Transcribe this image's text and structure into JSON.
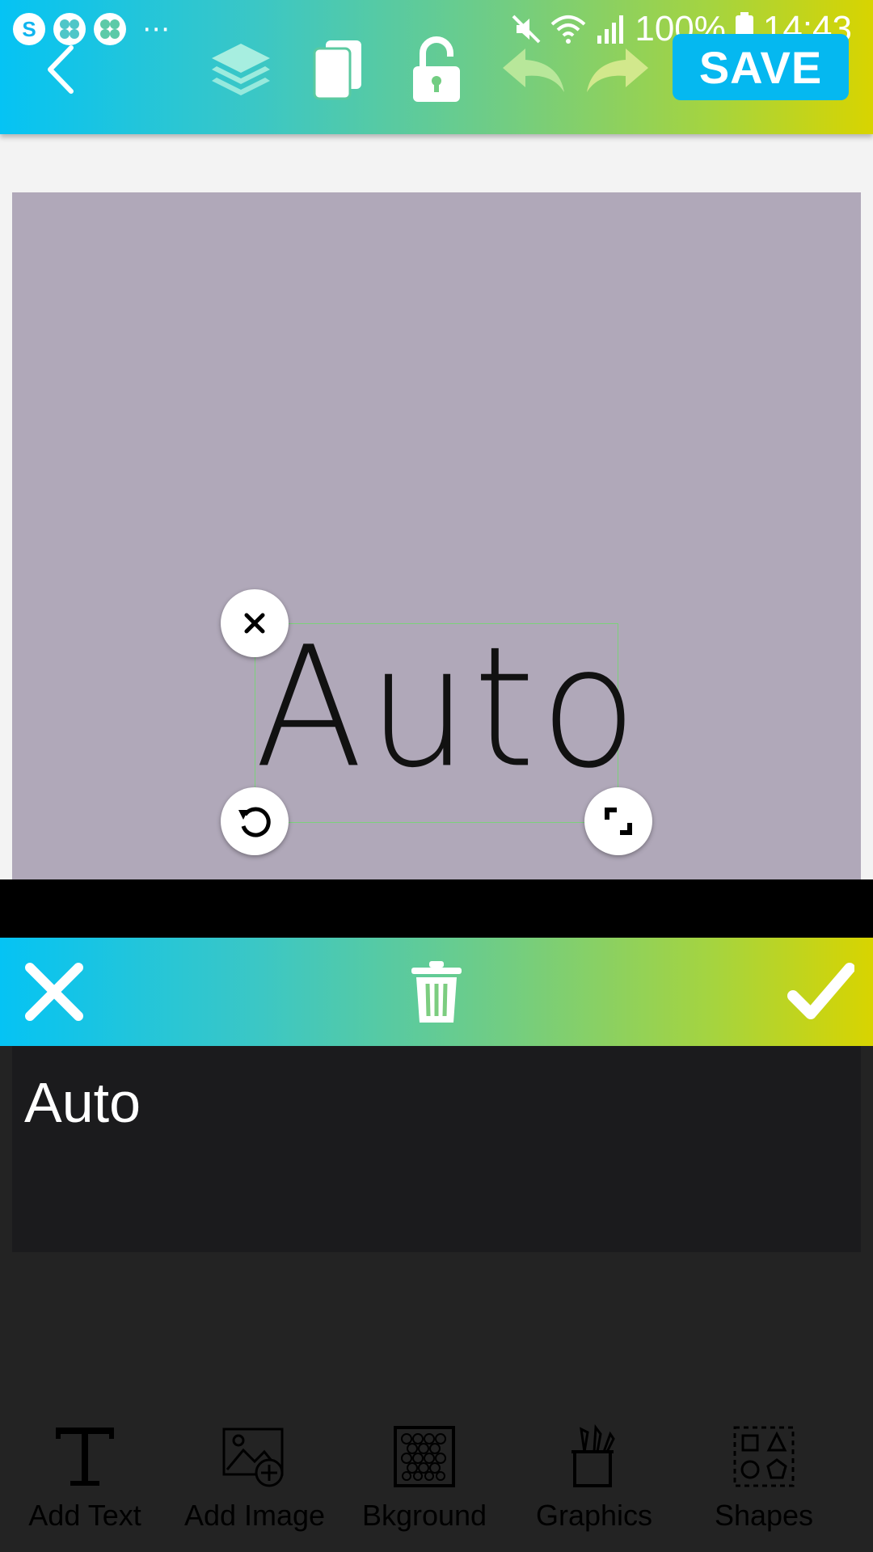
{
  "status_bar": {
    "battery": "100%",
    "time": "14:43",
    "more": "⋯"
  },
  "toolbar": {
    "save_label": "SAVE"
  },
  "canvas": {
    "text": "Auto",
    "background_color": "#b0a8b9"
  },
  "text_editor": {
    "value": "Auto"
  },
  "bottom_menu": {
    "items": [
      {
        "label": "Add Text",
        "icon": "text-icon"
      },
      {
        "label": "Add Image",
        "icon": "add-image-icon"
      },
      {
        "label": "Bkground",
        "icon": "background-icon"
      },
      {
        "label": "Graphics",
        "icon": "graphics-icon"
      },
      {
        "label": "Shapes",
        "icon": "shapes-icon"
      }
    ]
  },
  "colors": {
    "gradient_start": "#05c3f4",
    "gradient_end": "#d8d400",
    "save_button": "#05b8f0"
  }
}
